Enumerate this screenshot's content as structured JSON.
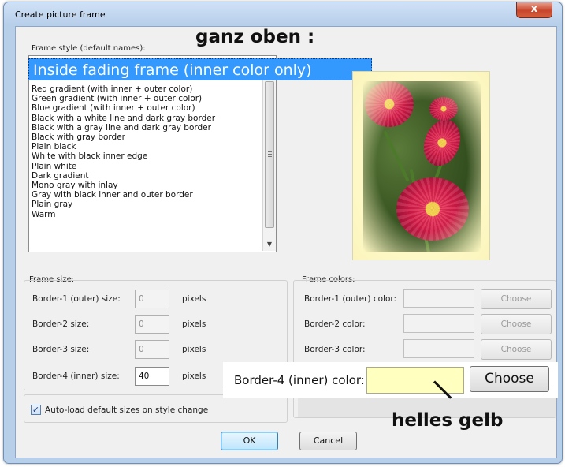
{
  "window": {
    "title": "Create picture frame",
    "close_glyph": "x"
  },
  "frame_style": {
    "label": "Frame style (default names):",
    "selected": "Inside fading frame (inner color only)",
    "items": [
      "Red gradient (with inner + outer color)",
      "Green gradient (with inner + outer color)",
      "Blue gradient (with inner + outer color)",
      "Black with a white line and dark gray border",
      "Black with a gray line and dark gray border",
      "Black with gray border",
      "Plain black",
      "White with black inner edge",
      "Plain white",
      "Dark gradient",
      "Mono gray with inlay",
      "Gray with black inner and outer border",
      "Plain gray",
      "Warm"
    ]
  },
  "annotations": {
    "top": "ganz oben :",
    "bottom": "helles gelb"
  },
  "frame_size": {
    "label": "Frame size:",
    "unit": "pixels",
    "fields": [
      {
        "label": "Border-1 (outer) size:",
        "value": "0"
      },
      {
        "label": "Border-2 size:",
        "value": "0"
      },
      {
        "label": "Border-3 size:",
        "value": "0"
      },
      {
        "label": "Border-4 (inner) size:",
        "value": "40"
      }
    ]
  },
  "frame_colors": {
    "label": "Frame colors:",
    "choose_label": "Choose",
    "fields": [
      {
        "label": "Border-1 (outer) color:"
      },
      {
        "label": "Border-2 color:"
      },
      {
        "label": "Border-3 color:"
      },
      {
        "label": "Border-4 (inner) color:",
        "color": "#ffffc0"
      }
    ]
  },
  "autoload": {
    "label": "Auto-load default sizes on style change",
    "checked": "✓"
  },
  "buttons": {
    "ok": "OK",
    "cancel": "Cancel"
  }
}
